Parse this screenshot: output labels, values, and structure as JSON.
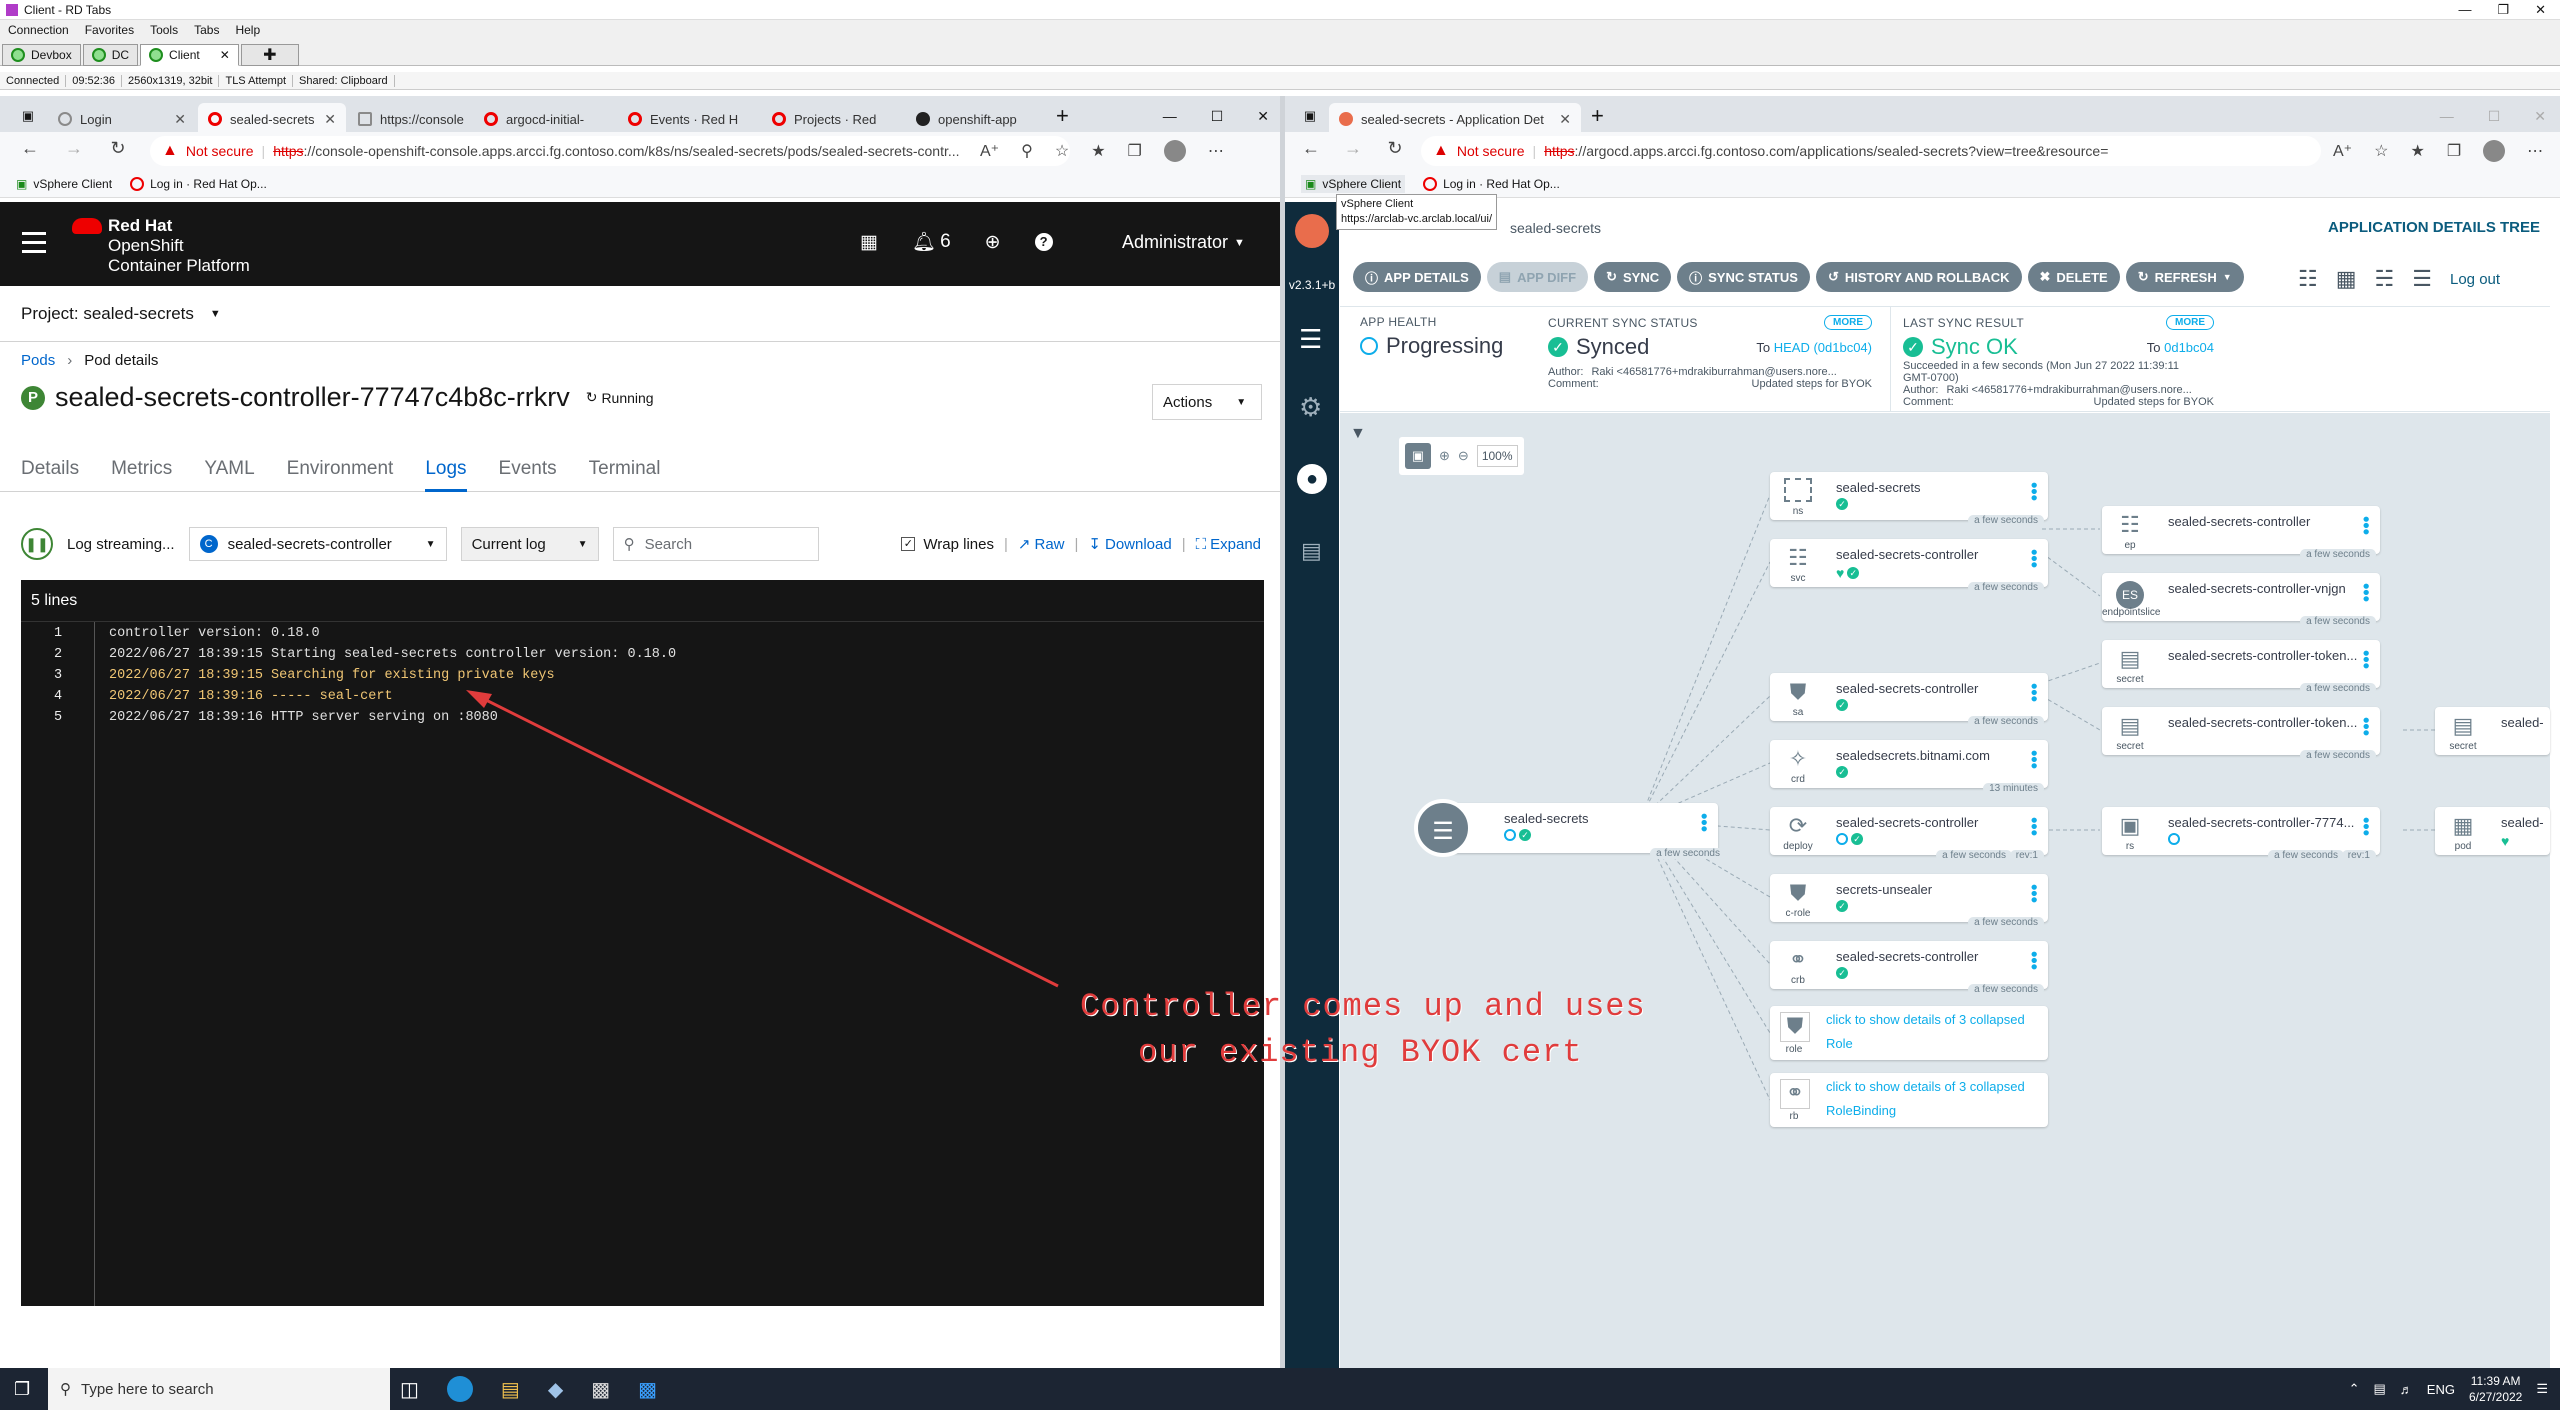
{
  "window": {
    "title": "Client - RD Tabs",
    "menu": [
      "Connection",
      "Favorites",
      "Tools",
      "Tabs",
      "Help"
    ]
  },
  "rd_tabs": [
    {
      "label": "Devbox"
    },
    {
      "label": "DC"
    },
    {
      "label": "Client"
    }
  ],
  "status_bar": {
    "state": "Connected",
    "time": "09:52:36",
    "resolution": "2560x1319, 32bit",
    "tls": "TLS Attempt",
    "shared": "Shared: Clipboard"
  },
  "left_browser": {
    "tabs": [
      "Login",
      "sealed-secrets",
      "https://console",
      "argocd-initial-",
      "Events · Red H",
      "Projects · Red",
      "openshift-app"
    ],
    "not_secure": "Not secure",
    "url_scheme": "https",
    "url_rest": "://console-openshift-console.apps.arcci.fg.contoso.com/k8s/ns/sealed-secrets/pods/sealed-secrets-contr...",
    "bookmarks": [
      "vSphere Client",
      "Log in · Red Hat Op..."
    ]
  },
  "openshift": {
    "brand1": "Red Hat",
    "brand2": "OpenShift",
    "brand3": "Container Platform",
    "notifications": "6",
    "user": "Administrator",
    "project": "Project: sealed-secrets",
    "breadcrumb": [
      "Pods",
      "Pod details"
    ],
    "pod_badge": "P",
    "pod_name": "sealed-secrets-controller-77747c4b8c-rrkrv",
    "pod_status": "Running",
    "actions": "Actions",
    "tabs": [
      "Details",
      "Metrics",
      "YAML",
      "Environment",
      "Logs",
      "Events",
      "Terminal"
    ],
    "log_streaming": "Log streaming...",
    "container_badge": "C",
    "container": "sealed-secrets-controller",
    "log_select": "Current log",
    "search_placeholder": "Search",
    "wrap_lines": "Wrap lines",
    "raw": "Raw",
    "download": "Download",
    "expand": "Expand",
    "lines_count": "5 lines",
    "log_lines": [
      {
        "n": "1",
        "text": "controller version: 0.18.0"
      },
      {
        "n": "2",
        "text": "2022/06/27 18:39:15 Starting sealed-secrets controller version: 0.18.0"
      },
      {
        "n": "3",
        "text": "2022/06/27 18:39:15 Searching for existing private keys"
      },
      {
        "n": "4",
        "text": "2022/06/27 18:39:16 ----- seal-cert"
      },
      {
        "n": "5",
        "text": "2022/06/27 18:39:16 HTTP server serving on :8080"
      }
    ]
  },
  "annotation": {
    "line1": "Controller comes up and uses",
    "line2": "our existing BYOK cert"
  },
  "right_browser": {
    "tab": "sealed-secrets - Application Det",
    "not_secure": "Not secure",
    "url_scheme": "https",
    "url_rest": "://argocd.apps.arcci.fg.contoso.com/applications/sealed-secrets?view=tree&resource=",
    "bookmarks": [
      "vSphere Client",
      "Log in · Red Hat Op..."
    ],
    "tooltip1": "vSphere Client",
    "tooltip2": "https://arclab-vc.arclab.local/ui/"
  },
  "argo": {
    "version": "v2.3.1+b",
    "app_title": "sealed-secrets",
    "header": "APPLICATION DETAILS TREE",
    "logout": "Log out",
    "buttons": [
      "APP DETAILS",
      "APP DIFF",
      "SYNC",
      "SYNC STATUS",
      "HISTORY AND ROLLBACK",
      "DELETE",
      "REFRESH"
    ],
    "health_label": "APP HEALTH",
    "health": "Progressing",
    "sync_label": "CURRENT SYNC STATUS",
    "sync": "Synced",
    "sync_to": "To",
    "sync_head": "HEAD (0d1bc04)",
    "more": "MORE",
    "sync_author_label": "Author:",
    "sync_author": "Raki <46581776+mdrakiburrahman@users.nore...",
    "comment_label": "Comment:",
    "comment": "Updated steps for BYOK",
    "last_label": "LAST SYNC RESULT",
    "last": "Sync OK",
    "last_to": "To",
    "last_rev": "0d1bc04",
    "last_time": "Succeeded in a few seconds (Mon Jun 27 2022 11:39:11",
    "last_tz": "GMT-0700)",
    "zoom": "100%",
    "root": {
      "name": "sealed-secrets",
      "age": "a few seconds"
    },
    "nodes": [
      {
        "name": "sealed-secrets",
        "kind": "ns",
        "age": "a few seconds"
      },
      {
        "name": "sealed-secrets-controller",
        "kind": "svc",
        "age": "a few seconds"
      },
      {
        "name": "sealed-secrets-controller",
        "kind": "sa",
        "age": "a few seconds"
      },
      {
        "name": "sealedsecrets.bitnami.com",
        "kind": "crd",
        "age": "13 minutes"
      },
      {
        "name": "sealed-secrets-controller",
        "kind": "deploy",
        "age": "a few seconds",
        "rev": "rev:1"
      },
      {
        "name": "secrets-unsealer",
        "kind": "c-role",
        "age": "a few seconds"
      },
      {
        "name": "sealed-secrets-controller",
        "kind": "crb",
        "age": "a few seconds"
      },
      {
        "name": "click to show details of 3 collapsed",
        "sub": "Role",
        "kind": "role"
      },
      {
        "name": "click to show details of 3 collapsed",
        "sub": "RoleBinding",
        "kind": "rb"
      }
    ],
    "nodes2": [
      {
        "name": "sealed-secrets-controller",
        "kind": "ep",
        "age": "a few seconds"
      },
      {
        "name": "sealed-secrets-controller-vnjgn",
        "kind": "endpointslice",
        "age": "a few seconds"
      },
      {
        "name": "sealed-secrets-controller-token...",
        "kind": "secret",
        "age": "a few seconds"
      },
      {
        "name": "sealed-secrets-controller-token...",
        "kind": "secret",
        "age": "a few seconds"
      },
      {
        "name": "sealed-secrets-controller-7774...",
        "kind": "rs",
        "age": "a few seconds",
        "rev": "rev:1"
      }
    ],
    "nodes3": [
      {
        "name": "sealed-",
        "kind": "secret"
      },
      {
        "name": "sealed-",
        "kind": "pod"
      }
    ]
  },
  "taskbar": {
    "search": "Type here to search",
    "lang": "ENG",
    "time": "11:39 AM",
    "date": "6/27/2022"
  }
}
